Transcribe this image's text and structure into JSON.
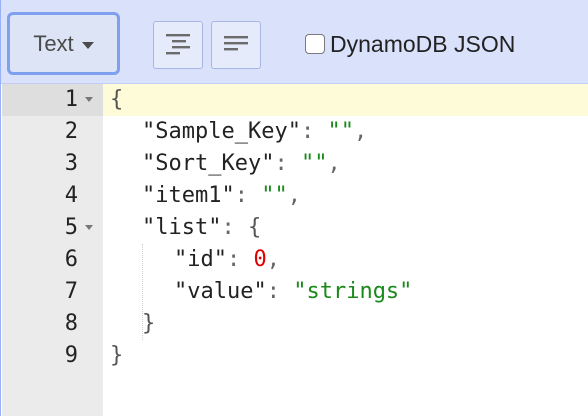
{
  "toolbar": {
    "mode_label": "Text",
    "format_icon": "format-icon",
    "compact_icon": "compact-icon",
    "dynamodb_label": "DynamoDB JSON",
    "dynamodb_checked": false
  },
  "editor": {
    "lines": [
      {
        "num": "1",
        "fold": true
      },
      {
        "num": "2",
        "fold": false
      },
      {
        "num": "3",
        "fold": false
      },
      {
        "num": "4",
        "fold": false
      },
      {
        "num": "5",
        "fold": true
      },
      {
        "num": "6",
        "fold": false
      },
      {
        "num": "7",
        "fold": false
      },
      {
        "num": "8",
        "fold": false
      },
      {
        "num": "9",
        "fold": false
      }
    ],
    "tokens": {
      "l1_open": "{",
      "l2_key": "\"Sample_Key\"",
      "l2_val": "\"\"",
      "l3_key": "\"Sort_Key\"",
      "l3_val": "\"\"",
      "l4_key": "\"item1\"",
      "l4_val": "\"\"",
      "l5_key": "\"list\"",
      "l5_open": "{",
      "l6_key": "\"id\"",
      "l6_val": "0",
      "l7_key": "\"value\"",
      "l7_val": "\"strings\"",
      "l8_close": "}",
      "l9_close": "}",
      "colon": ": ",
      "comma": ","
    }
  },
  "colors": {
    "toolbar_bg": "#d9e1fb",
    "string": "#1a8a1a",
    "number": "#e00000",
    "active_line": "#fefbd9",
    "gutter": "#ebebeb"
  }
}
